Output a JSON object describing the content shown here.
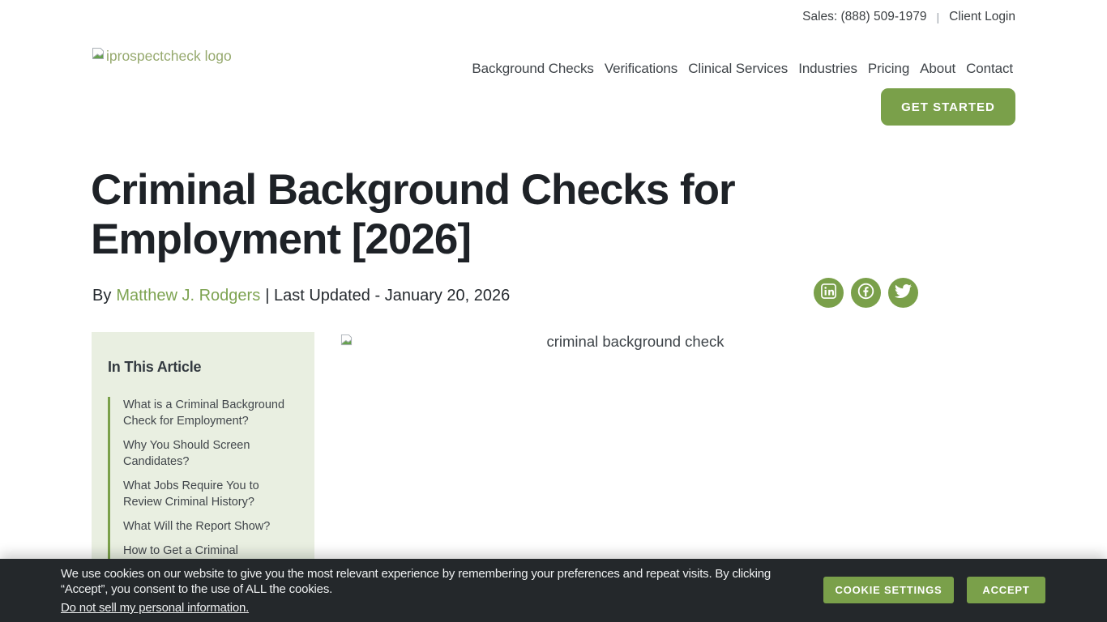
{
  "topbar": {
    "sales": "Sales: (888) 509-1979",
    "divider": "|",
    "client_login": "Client Login"
  },
  "header": {
    "logo_alt": "iprospectcheck logo",
    "nav_items": [
      "Background Checks",
      "Verifications",
      "Clinical Services",
      "Industries",
      "Pricing",
      "About",
      "Contact"
    ],
    "cta_label": "GET STARTED"
  },
  "article": {
    "title": "Criminal Background Checks for Employment [2026]",
    "byline": {
      "prefix": "By",
      "author": "Matthew J. Rodgers",
      "suffix": "| Last Updated - January 20, 2026"
    },
    "social_icons": [
      "linkedin",
      "facebook",
      "twitter"
    ],
    "toc": {
      "title": "In This Article",
      "items": [
        "What is a Criminal Background Check for Employment?",
        "Why You Should Screen Candidates?",
        "What Jobs Require You to Review Criminal History?",
        "What Will the Report Show?",
        "How to Get a Criminal"
      ]
    },
    "hero_image_alt": "criminal background check"
  },
  "cookie_banner": {
    "message": "We use cookies on our website to give you the most relevant experience by remembering your preferences and repeat visits. By clicking “Accept”, you consent to the use of ALL the cookies.",
    "link": "Do not sell my personal information.",
    "settings_label": "COOKIE SETTINGS",
    "accept_label": "ACCEPT"
  },
  "colors": {
    "accent_green": "#7aa04a",
    "toc_background": "#e9efe1",
    "banner_background": "#24282b"
  }
}
